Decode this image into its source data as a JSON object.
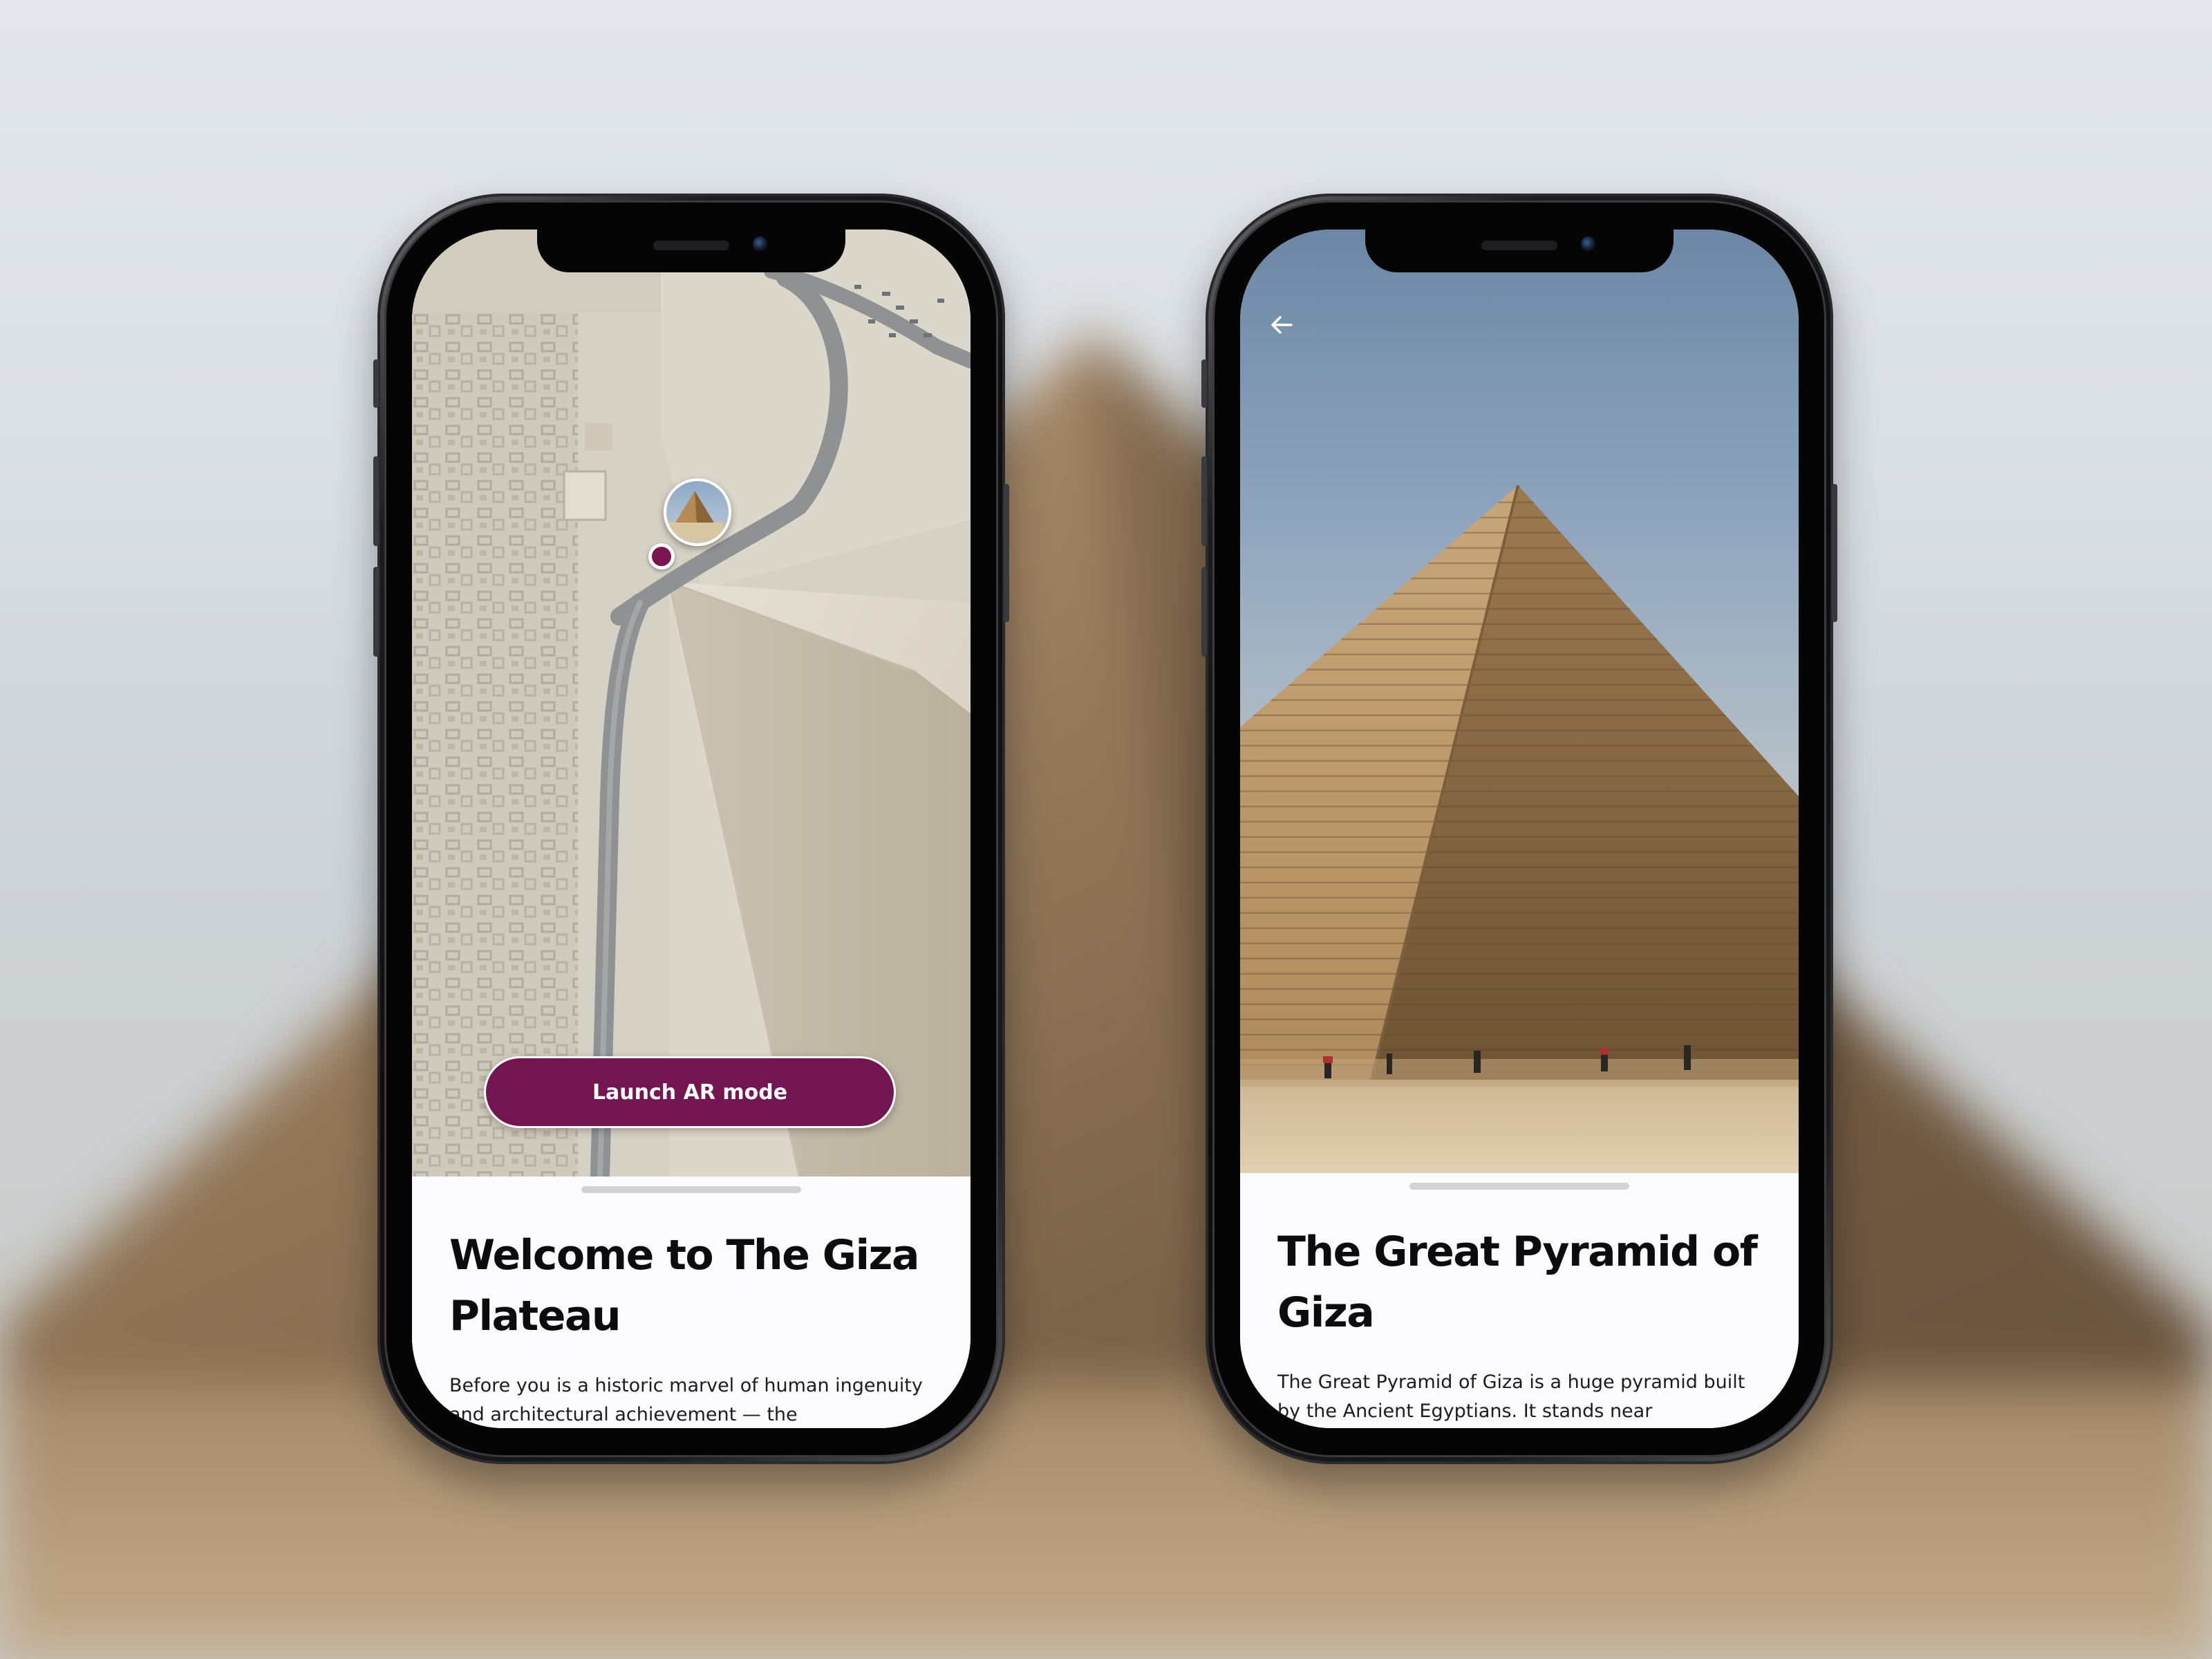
{
  "colors": {
    "accent": "#731550",
    "sheet_background": "#fbfbfd",
    "title_text": "#0c0c10"
  },
  "phone_left": {
    "map": {
      "landmark_pin_icon": "pyramid-thumbnail-pin",
      "location_icon": "current-location-dot"
    },
    "ar_button": {
      "label": "Launch AR mode"
    },
    "sheet": {
      "title": "Welcome to The Giza Plateau",
      "body": "Before you is a historic marvel of human ingenuity and architectural achievement — the"
    }
  },
  "phone_right": {
    "header": {
      "back_icon": "arrow-left-icon"
    },
    "sheet": {
      "title": "The Great Pyramid of Giza",
      "body": "The Great Pyramid of Giza is a huge pyramid built by the Ancient Egyptians. It stands near"
    }
  }
}
